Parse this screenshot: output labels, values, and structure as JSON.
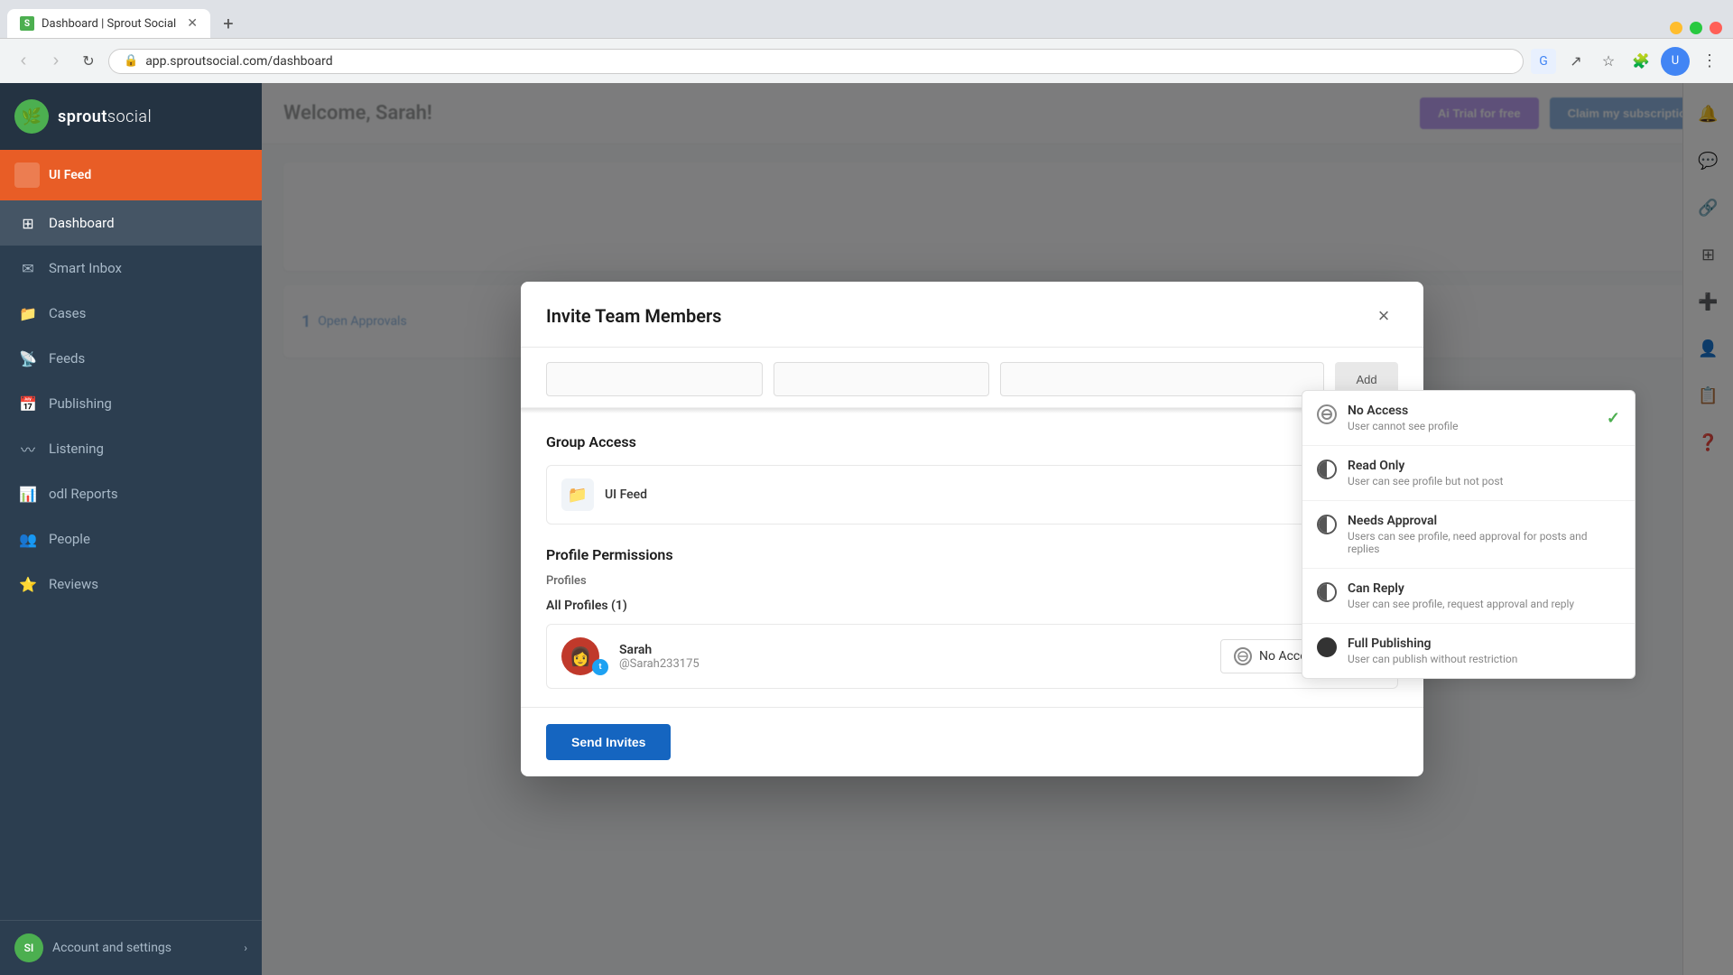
{
  "browser": {
    "tab_title": "Dashboard | Sprout Social",
    "tab_favicon": "S",
    "url": "app.sproutsocial.com/dashboard",
    "new_tab_label": "+"
  },
  "sidebar": {
    "brand": "sproutsocial",
    "brand_part1": "sprout",
    "brand_part2": "social",
    "ui_feed_label": "UI Feed",
    "nav_items": [
      {
        "label": "Dashboard",
        "icon": "⊞",
        "active": true
      },
      {
        "label": "Smart Inbox",
        "icon": "✉"
      },
      {
        "label": "Cases",
        "icon": "📁"
      },
      {
        "label": "Feeds",
        "icon": "📡"
      },
      {
        "label": "Publishing",
        "icon": "📅"
      },
      {
        "label": "Listening",
        "icon": "👂"
      },
      {
        "label": "Reports",
        "icon": "📊"
      },
      {
        "label": "People",
        "icon": "👥"
      },
      {
        "label": "Reviews",
        "icon": "⭐"
      }
    ],
    "footer": {
      "label": "Account and settings",
      "initials": "SI"
    }
  },
  "modal": {
    "title": "Invite Team Members",
    "close_label": "×",
    "group_access_title": "Group Access",
    "group_name": "UI Feed",
    "profile_permissions_title": "Profile Permissions",
    "profiles_column_label": "Profiles",
    "all_profiles_label": "All Profiles (1)",
    "profile": {
      "name": "Sarah",
      "handle": "@Sarah233175",
      "platform": "Twitter"
    },
    "access_label": "No Access",
    "send_button": "Send Invites"
  },
  "dropdown": {
    "items": [
      {
        "id": "no-access",
        "title": "No Access",
        "description": "User cannot see profile",
        "selected": true,
        "icon_type": "banned"
      },
      {
        "id": "read-only",
        "title": "Read Only",
        "description": "User can see profile but not post",
        "selected": false,
        "icon_type": "half"
      },
      {
        "id": "needs-approval",
        "title": "Needs Approval",
        "description": "Users can see profile, need approval for posts and replies",
        "selected": false,
        "icon_type": "half"
      },
      {
        "id": "can-reply",
        "title": "Can Reply",
        "description": "User can see profile, request approval and reply",
        "selected": false,
        "icon_type": "half"
      },
      {
        "id": "full-publishing",
        "title": "Full Publishing",
        "description": "User can publish without restriction",
        "selected": false,
        "icon_type": "filled"
      }
    ]
  },
  "background": {
    "welcome_text": "Welcome, Sarah!",
    "trial_btn": "Ai Trial for free",
    "subscription_btn": "Claim my subscription",
    "open_approvals_label": "Open Approvals",
    "approvals_count": "1"
  }
}
